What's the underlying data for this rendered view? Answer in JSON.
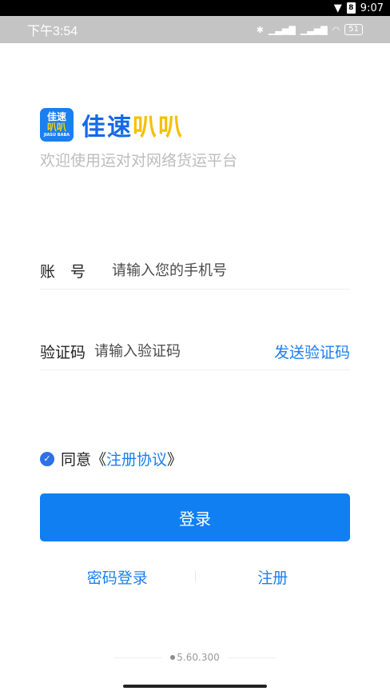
{
  "system_bar": {
    "time": "9:07",
    "battery": "8"
  },
  "status_bar": {
    "time": "下午3:54",
    "battery": "51"
  },
  "brand": {
    "icon_line1": "佳速",
    "icon_line2": "叭叭",
    "icon_line3": "JIASU BABA",
    "name_part1": "佳速",
    "name_part2": "叭叭",
    "tagline": "欢迎使用运对对网络货运平台"
  },
  "form": {
    "account_label": "账　号",
    "account_placeholder": "请输入您的手机号",
    "code_label": "验证码",
    "code_placeholder": "请输入验证码",
    "send_code": "发送验证码"
  },
  "agreement": {
    "prefix": "同意《",
    "link": "注册协议",
    "suffix": "》",
    "checked": true
  },
  "login_button": "登录",
  "links": {
    "password_login": "密码登录",
    "register": "注册"
  },
  "version": "5.60.300",
  "colors": {
    "primary": "#0f7ff2",
    "link": "#1a7ff0",
    "brand_yellow": "#f5c000"
  }
}
